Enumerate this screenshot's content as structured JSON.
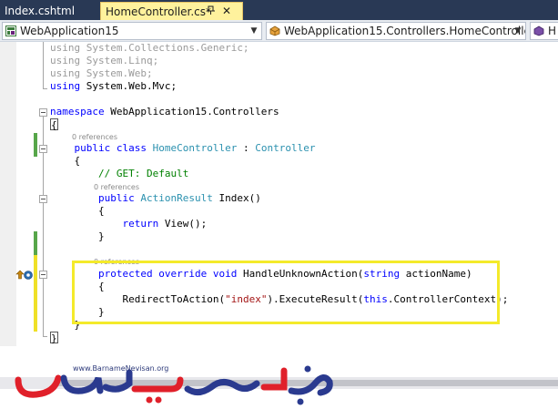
{
  "tabs": [
    {
      "label": "Index.cshtml",
      "active": false
    },
    {
      "label": "HomeController.cs*",
      "active": true
    }
  ],
  "navbar": {
    "project": "WebApplication15",
    "type": "WebApplication15.Controllers.HomeController",
    "member": "H"
  },
  "editor": {
    "usings": [
      {
        "kw": "using",
        "ns": "System.Collections.Generic;"
      },
      {
        "kw": "using",
        "ns": "System.Linq;"
      },
      {
        "kw": "using",
        "ns": "System.Web;"
      },
      {
        "kw": "using",
        "ns": "System.Web.Mvc;"
      }
    ],
    "namespace_kw": "namespace",
    "namespace_name": "WebApplication15.Controllers",
    "open_brace": "{",
    "close_brace": "}",
    "references_label": "0 references",
    "class_public": "public",
    "class_kw": "class",
    "class_name": "HomeController",
    "class_sep": ":",
    "class_base": "Controller",
    "comment": "// GET: Default",
    "index_public": "public",
    "index_return_type": "ActionResult",
    "index_signature": "Index()",
    "return_kw": "return",
    "return_expr": "View();",
    "override_protected": "protected",
    "override_kw": "override",
    "override_void": "void",
    "override_name": "HandleUnknownAction(",
    "override_param_type": "string",
    "override_param_rest": "actionName)",
    "redirect_call": "RedirectToAction(",
    "redirect_arg": "\"index\"",
    "redirect_mid": ").ExecuteResult(",
    "redirect_this": "this",
    "redirect_end": ".ControllerContext);"
  },
  "logo": {
    "url": "www.BarnameNevisan.org",
    "colors": {
      "blue": "#2a3a8f",
      "red": "#e0202a"
    }
  }
}
